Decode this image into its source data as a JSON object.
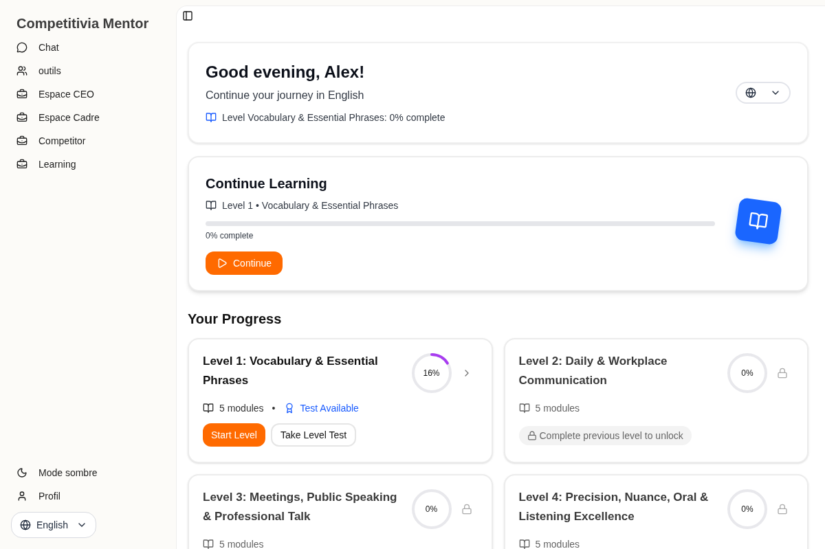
{
  "sidebar": {
    "title": "Competitivia Mentor",
    "items": [
      {
        "label": "Chat",
        "kind": "chat"
      },
      {
        "label": "outils",
        "kind": "users"
      },
      {
        "label": "Espace CEO",
        "kind": "briefcase"
      },
      {
        "label": "Espace Cadre",
        "kind": "briefcase"
      },
      {
        "label": "Competitor",
        "kind": "briefcase"
      },
      {
        "label": "Learning",
        "kind": "briefcase"
      }
    ],
    "bottom_items": [
      {
        "label": "Mode sombre",
        "kind": "moon"
      },
      {
        "label": "Profil",
        "kind": "user"
      }
    ],
    "language": "English"
  },
  "welcome": {
    "title": "Good evening, Alex!",
    "subtitle": "Continue your journey in English",
    "status": "Level Vocabulary & Essential Phrases: 0% complete"
  },
  "continue_card": {
    "title": "Continue Learning",
    "level_label": "Level 1 • Vocabulary & Essential Phrases",
    "level": 0,
    "progress_label": "0% complete",
    "button": "Continue"
  },
  "progress": {
    "title": "Your Progress",
    "levels": [
      {
        "title": "Level 1: Vocabulary & Essential Phrases",
        "level": 0.16,
        "percent": "16%",
        "locked": false,
        "modules": "5 modules",
        "separator": "•",
        "test": "Test Available",
        "buttons": [
          "Start Level",
          "Take Level Test"
        ]
      },
      {
        "title": "Level 2: Daily & Workplace Communication",
        "percent": "0%",
        "locked": true,
        "modules": "5 modules",
        "lock_note": "Complete previous level to unlock"
      },
      {
        "title": "Level 3: Meetings, Public Speaking & Professional Talk",
        "percent": "0%",
        "locked": true,
        "modules": "5 modules"
      },
      {
        "title": "Level 4: Precision, Nuance, Oral & Listening Excellence",
        "percent": "0%",
        "locked": true,
        "modules": "5 modules"
      }
    ]
  }
}
